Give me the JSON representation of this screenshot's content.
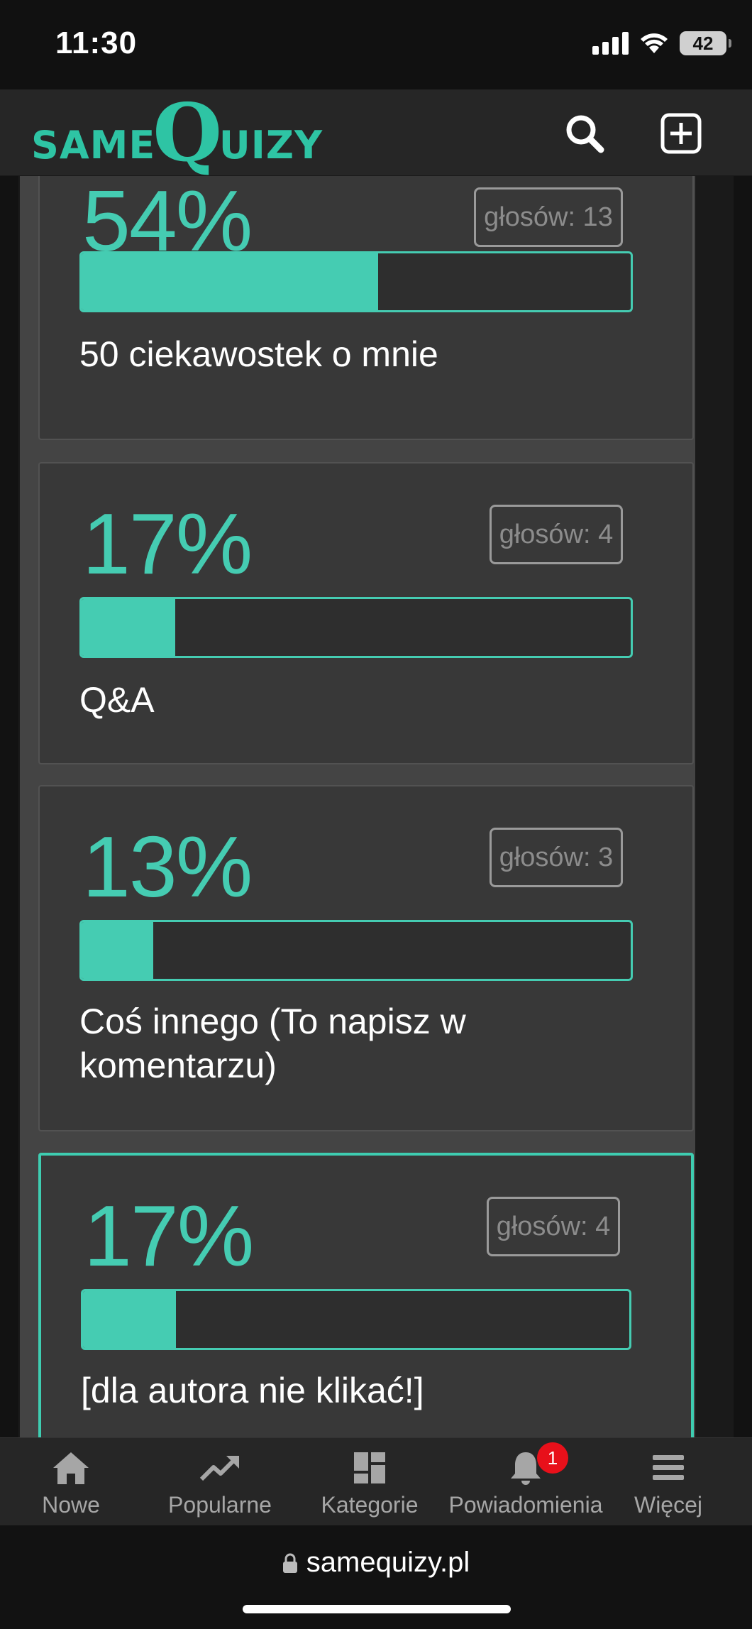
{
  "status_bar": {
    "time": "11:30",
    "battery": "42"
  },
  "header": {
    "logo_small_1": "SAME",
    "logo_big": "Q",
    "logo_small_2": "UIZY",
    "search_icon": "search-icon",
    "add_icon": "plus-square-icon"
  },
  "results": [
    {
      "percent_label": "54%",
      "percent": 54,
      "votes_label": "głosów: 13",
      "answer": "50 ciekawostek o mnie",
      "selected": false
    },
    {
      "percent_label": "17%",
      "percent": 17,
      "votes_label": "głosów: 4",
      "answer": "Q&A",
      "selected": false
    },
    {
      "percent_label": "13%",
      "percent": 13,
      "votes_label": "głosów: 3",
      "answer": "Coś innego (To napisz w komentarzu)",
      "selected": false
    },
    {
      "percent_label": "17%",
      "percent": 17,
      "votes_label": "głosów: 4",
      "answer": "[dla autora nie klikać!]",
      "selected": true
    }
  ],
  "bottom_nav": {
    "items": [
      {
        "label": "Nowe",
        "icon": "home-icon"
      },
      {
        "label": "Popularne",
        "icon": "trending-icon"
      },
      {
        "label": "Kategorie",
        "icon": "grid-icon"
      },
      {
        "label": "Powiadomienia",
        "icon": "bell-icon",
        "badge": "1"
      },
      {
        "label": "Więcej",
        "icon": "menu-icon"
      }
    ]
  },
  "browser": {
    "url": "samequizy.pl"
  },
  "colors": {
    "accent": "#45ccb2",
    "logo": "#2ec4a4",
    "badge": "#e8101a"
  }
}
